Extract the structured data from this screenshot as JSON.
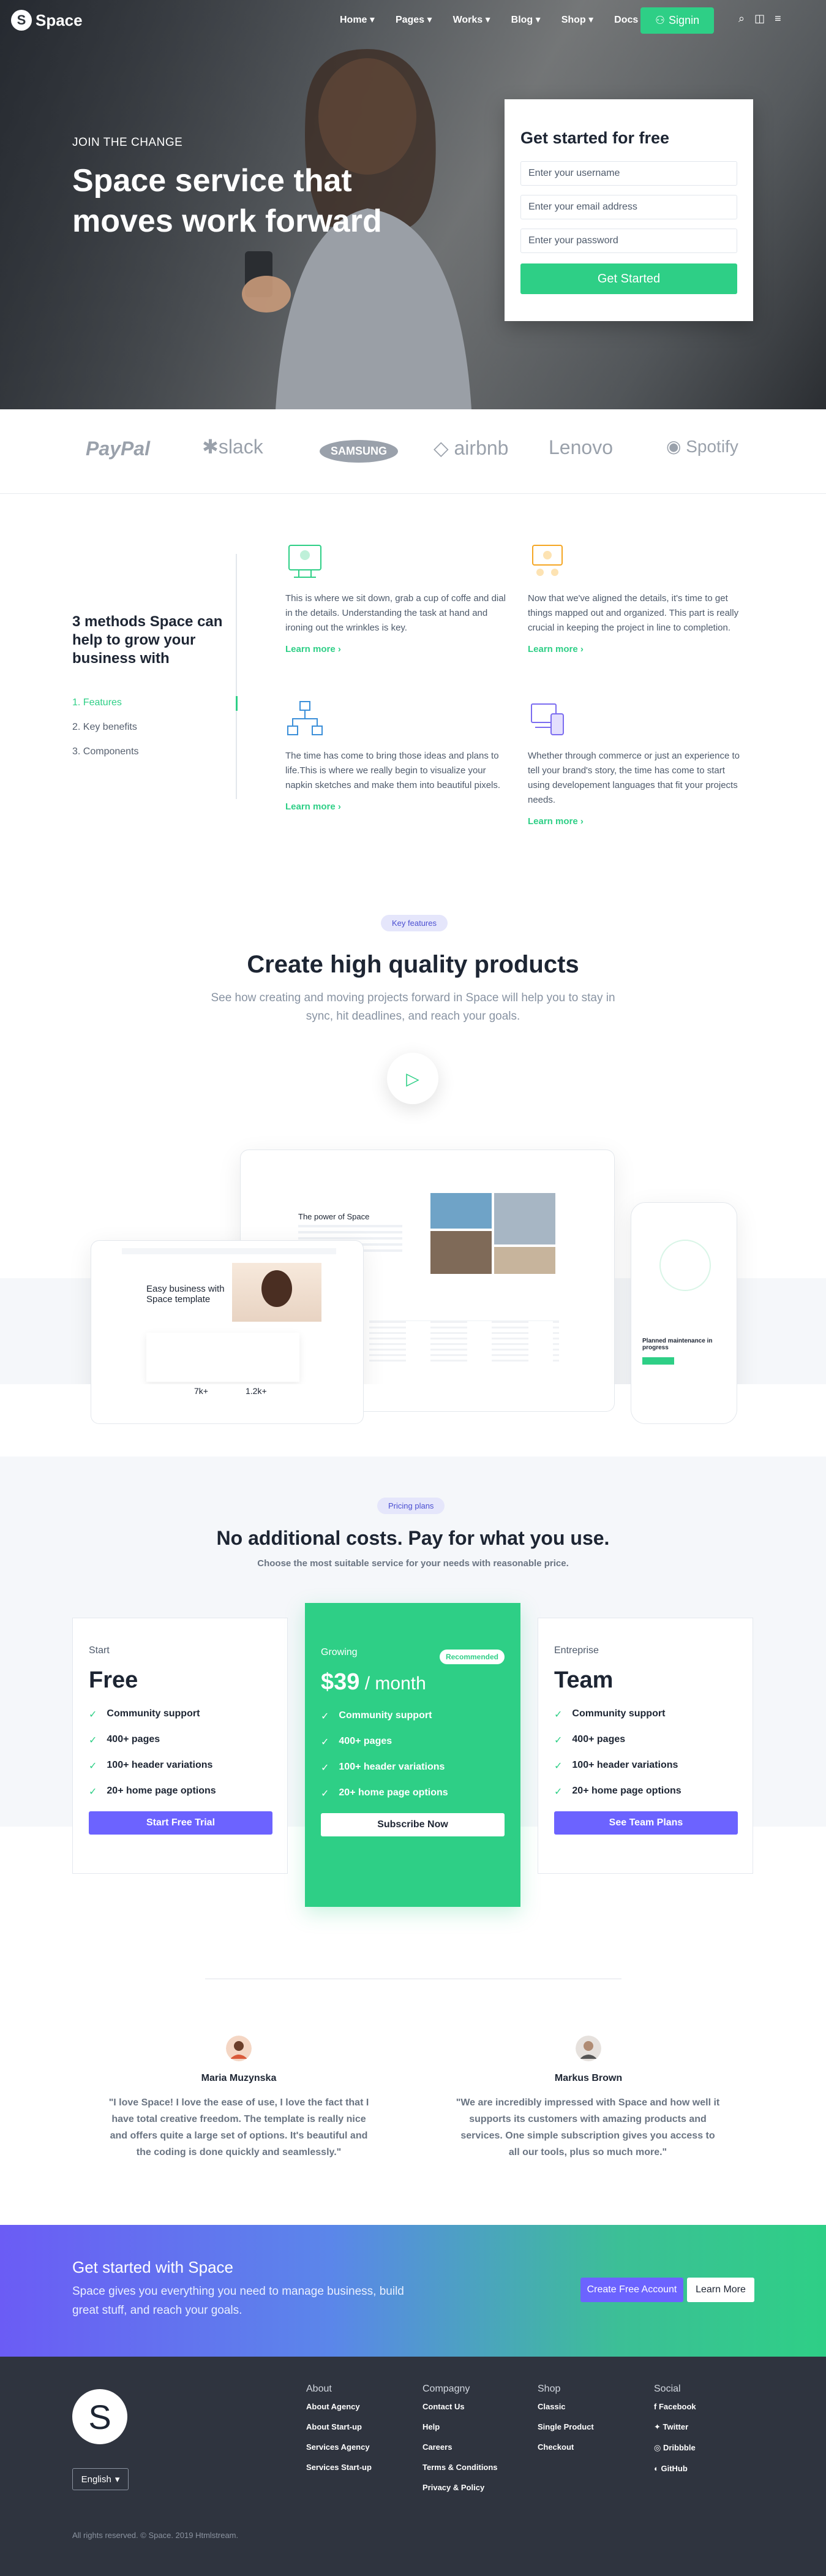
{
  "nav": {
    "brand": "Space",
    "items": [
      "Home",
      "Pages",
      "Works",
      "Blog",
      "Shop",
      "Docs"
    ],
    "signin": "Signin"
  },
  "hero": {
    "tag": "JOIN THE CHANGE",
    "title": "Space service that moves work forward",
    "form_title": "Get started for free",
    "username_placeholder": "Enter your username",
    "email_placeholder": "Enter your email address",
    "password_placeholder": "Enter your password",
    "submit": "Get Started"
  },
  "brands": [
    "PayPal",
    "slack",
    "SAMSUNG",
    "airbnb",
    "Lenovo",
    "Spotify"
  ],
  "methods": {
    "heading": "3 methods Space can help to grow your business with",
    "links": [
      "1. Features",
      "2. Key benefits",
      "3. Components"
    ],
    "features": [
      {
        "text": "This is where we sit down, grab a cup of coffe and dial in the details. Understanding the task at hand and ironing out the wrinkles is key.",
        "link": "Learn more ›"
      },
      {
        "text": "Now that we've aligned the details, it's time to get things mapped out and organized. This part is really crucial in keeping the project in line to completion.",
        "link": "Learn more ›"
      },
      {
        "text": "The time has come to bring those ideas and plans to life.This is where we really begin to visualize your napkin sketches and make them into beautiful pixels.",
        "link": "Learn more ›"
      },
      {
        "text": "Whether through commerce or just an experience to tell your brand's story, the time has come to start using developement languages that fit your projects needs.",
        "link": "Learn more ›"
      }
    ]
  },
  "key_features": {
    "pill": "Key features",
    "title": "Create high quality products",
    "subtitle": "See how creating and moving projects forward in Space will help you to stay in sync, hit deadlines, and reach your goals.",
    "mock_desktop_title": "The power of Space",
    "mock_laptop_title": "Easy business with Space template",
    "mock_stats": [
      "7k+",
      "1.2k+"
    ],
    "mock_phone_title": "Planned maintenance in progress"
  },
  "pricing": {
    "pill": "Pricing plans",
    "title": "No additional costs. Pay for what you use.",
    "subtitle": "Choose the most suitable service for your needs with reasonable price.",
    "plans": [
      {
        "tier": "Start",
        "price": "Free",
        "unit": "",
        "features": [
          "Community support",
          "400+ pages",
          "100+ header variations",
          "20+ home page options"
        ],
        "button": "Start Free Trial"
      },
      {
        "tier": "Growing",
        "price": "$39",
        "unit": " / month",
        "badge": "Recommended",
        "features": [
          "Community support",
          "400+ pages",
          "100+ header variations",
          "20+ home page options"
        ],
        "button": "Subscribe Now"
      },
      {
        "tier": "Entreprise",
        "price": "Team",
        "unit": "",
        "features": [
          "Community support",
          "400+ pages",
          "100+ header variations",
          "20+ home page options"
        ],
        "button": "See Team Plans"
      }
    ]
  },
  "testimonials": [
    {
      "name": "Maria Muzynska",
      "quote": "\"I love Space! I love the ease of use, I love the fact that I have total creative freedom. The template is really nice and offers quite a large set of options. It's beautiful and the coding is done quickly and seamlessly.\""
    },
    {
      "name": "Markus Brown",
      "quote": "\"We are incredibly impressed with Space and how well it supports its customers with amazing products and services. One simple subscription gives you access to all our tools, plus so much more.\""
    }
  ],
  "cta": {
    "title": "Get started with Space",
    "text": "Space gives you everything you need to manage business, build great stuff, and reach your goals.",
    "primary": "Create Free Account",
    "secondary": "Learn More"
  },
  "footer": {
    "logo": "S",
    "language": "English",
    "columns": [
      {
        "title": "About",
        "links": [
          "About Agency",
          "About Start-up",
          "Services Agency",
          "Services Start-up"
        ]
      },
      {
        "title": "Compagny",
        "links": [
          "Contact Us",
          "Help",
          "Careers",
          "Terms & Conditions",
          "Privacy & Policy"
        ]
      },
      {
        "title": "Shop",
        "links": [
          "Classic",
          "Single Product",
          "Checkout"
        ]
      },
      {
        "title": "Social",
        "links": [
          "Facebook",
          "Twitter",
          "Dribbble",
          "GitHub"
        ]
      }
    ],
    "copyright": "All rights reserved. © Space. 2019 Htmlstream."
  },
  "colors": {
    "accent": "#2ecf86",
    "purple": "#6c63ff",
    "dark": "#2f343f"
  }
}
